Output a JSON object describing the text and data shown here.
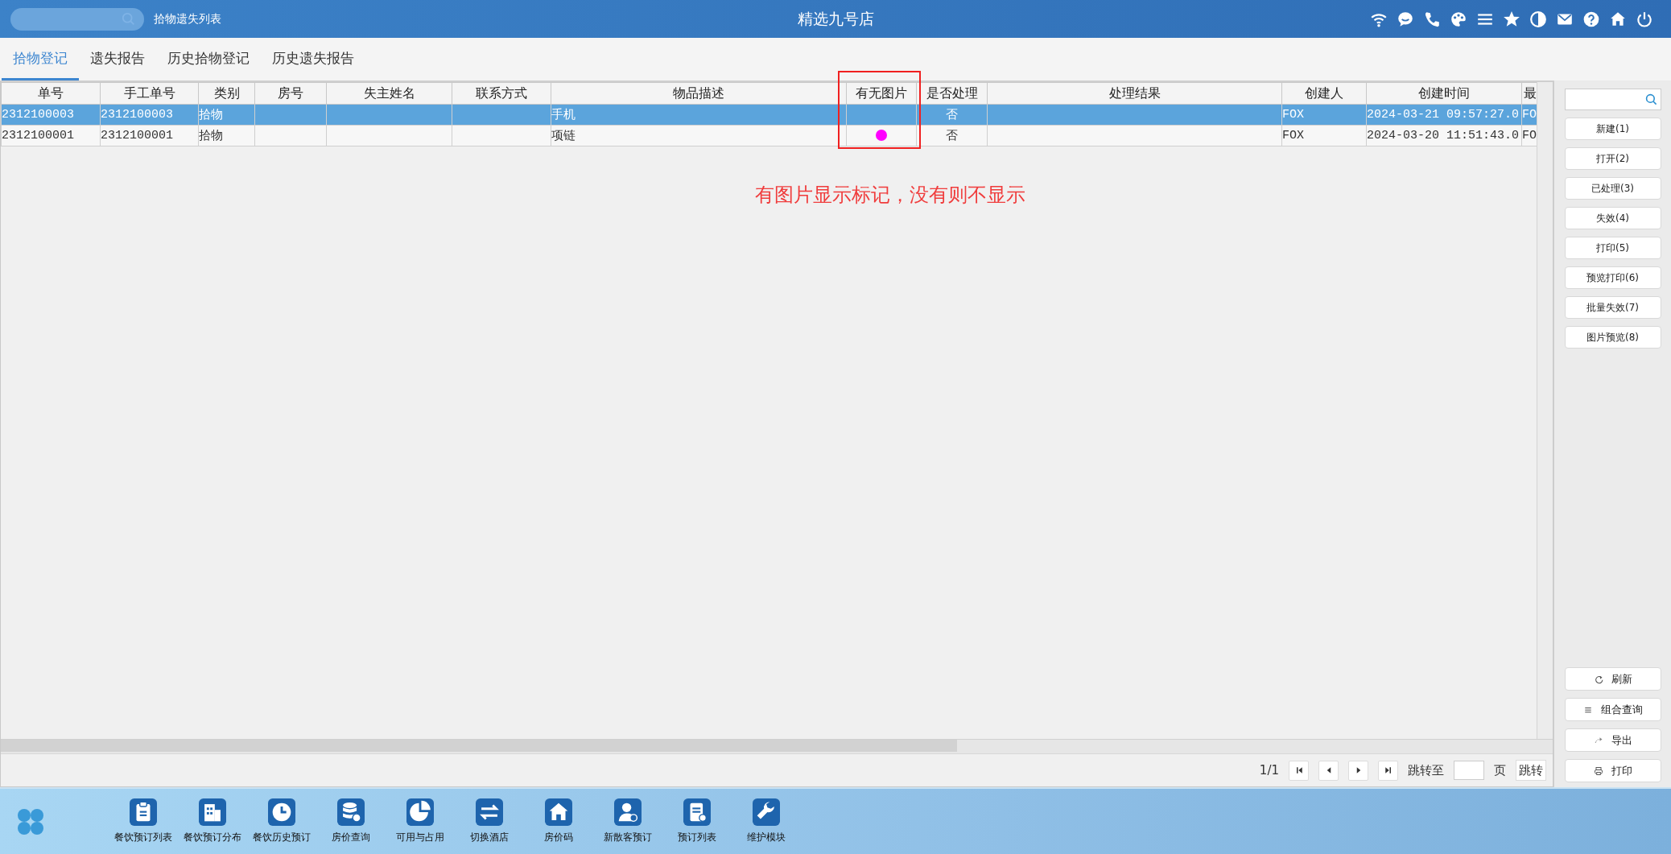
{
  "header": {
    "page_title": "拾物遗失列表",
    "hotel_name": "精选九号店"
  },
  "tabs": [
    {
      "label": "拾物登记",
      "selected": true
    },
    {
      "label": "遗失报告",
      "selected": false
    },
    {
      "label": "历史拾物登记",
      "selected": false
    },
    {
      "label": "历史遗失报告",
      "selected": false
    }
  ],
  "table": {
    "columns": [
      "单号",
      "手工单号",
      "类别",
      "房号",
      "失主姓名",
      "联系方式",
      "物品描述",
      "有无图片",
      "是否处理",
      "处理结果",
      "创建人",
      "创建时间",
      "最"
    ],
    "rows": [
      {
        "selected": true,
        "order_no": "2312100003",
        "manual_no": "2312100003",
        "category": "拾物",
        "description": "手机",
        "has_picture": false,
        "processed": "否",
        "creator": "FOX",
        "created_at": "2024-03-21 09:57:27.0",
        "column_13": "FO"
      },
      {
        "selected": false,
        "order_no": "2312100001",
        "manual_no": "2312100001",
        "category": "拾物",
        "description": "项链",
        "has_picture": true,
        "processed": "否",
        "creator": "FOX",
        "created_at": "2024-03-20 11:51:43.0",
        "column_13": "FO"
      }
    ]
  },
  "annotation": {
    "note": "有图片显示标记，没有则不显示"
  },
  "pagination": {
    "page": "1/1",
    "jump_label": "跳转至",
    "page_unit": "页",
    "jump_button": "跳转"
  },
  "actions": [
    "新建(1)",
    "打开(2)",
    "已处理(3)",
    "失效(4)",
    "打印(5)",
    "预览打印(6)",
    "批量失效(7)",
    "图片预览(8)"
  ],
  "tools": [
    {
      "kind": "refresh",
      "label": "刷新"
    },
    {
      "kind": "query",
      "label": "组合查询"
    },
    {
      "kind": "export",
      "label": "导出"
    },
    {
      "kind": "print",
      "label": "打印"
    }
  ],
  "taskbar": [
    {
      "kind": "clipboard",
      "label": "餐饮预订列表"
    },
    {
      "kind": "building",
      "label": "餐饮预订分布"
    },
    {
      "kind": "clock",
      "label": "餐饮历史预订"
    },
    {
      "kind": "database",
      "label": "房价查询"
    },
    {
      "kind": "pie",
      "label": "可用与占用"
    },
    {
      "kind": "swap",
      "label": "切换酒店"
    },
    {
      "kind": "home",
      "label": "房价码"
    },
    {
      "kind": "person",
      "label": "新散客预订"
    },
    {
      "kind": "document",
      "label": "预订列表"
    },
    {
      "kind": "wrench",
      "label": "维护模块"
    }
  ]
}
